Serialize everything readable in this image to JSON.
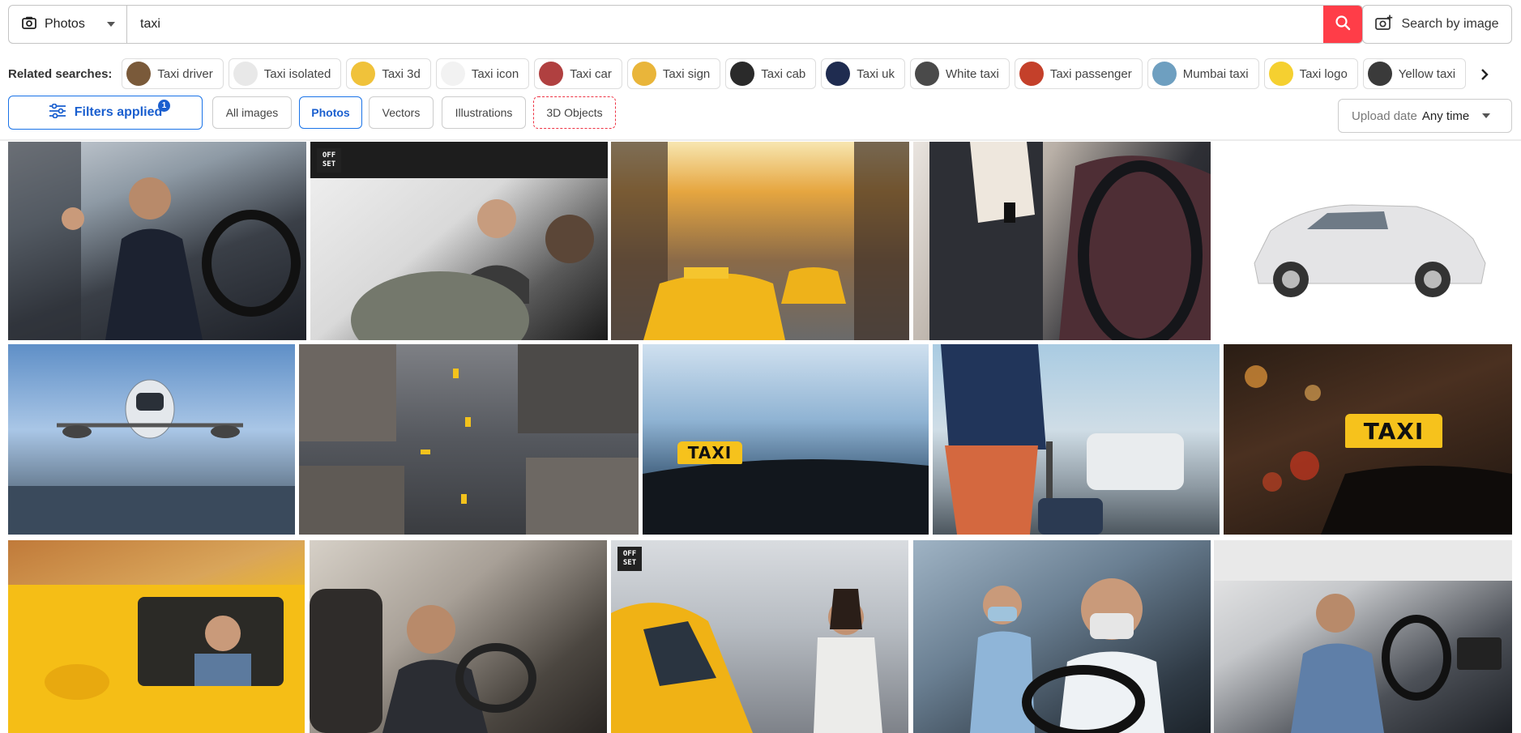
{
  "search": {
    "type_label": "Photos",
    "query": "taxi",
    "search_by_image_label": "Search by image"
  },
  "related": {
    "label": "Related searches:",
    "items": [
      {
        "label": "Taxi driver",
        "thumb": "#7a5a3a"
      },
      {
        "label": "Taxi isolated",
        "thumb": "#e8e8e8"
      },
      {
        "label": "Taxi 3d",
        "thumb": "#f0c23a"
      },
      {
        "label": "Taxi icon",
        "thumb": "#f2f2f2"
      },
      {
        "label": "Taxi car",
        "thumb": "#b04040"
      },
      {
        "label": "Taxi sign",
        "thumb": "#e9b53a"
      },
      {
        "label": "Taxi cab",
        "thumb": "#2a2a2a"
      },
      {
        "label": "Taxi uk",
        "thumb": "#1f2c50"
      },
      {
        "label": "White taxi",
        "thumb": "#4a4a4a"
      },
      {
        "label": "Taxi passenger",
        "thumb": "#c4402a"
      },
      {
        "label": "Mumbai taxi",
        "thumb": "#6e9fc0"
      },
      {
        "label": "Taxi logo",
        "thumb": "#f5d030"
      },
      {
        "label": "Yellow taxi",
        "thumb": "#3a3a3a"
      }
    ]
  },
  "filters": {
    "applied_label": "Filters applied",
    "count": "1",
    "content_types": [
      "All images",
      "Photos",
      "Vectors",
      "Illustrations",
      "3D Objects"
    ],
    "active_type": "Photos",
    "upload_date_label": "Upload date",
    "upload_date_value": "Any time"
  },
  "offset_badge": "OFF\nSET",
  "taxi_sign_text": "TAXI",
  "colors": {
    "accent": "#1a73e8",
    "search_button": "#ff3d48"
  }
}
